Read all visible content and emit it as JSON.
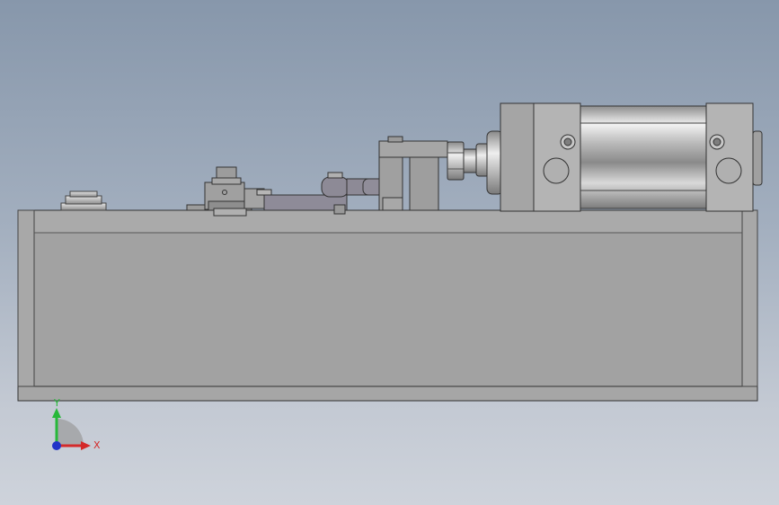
{
  "viewport": {
    "background_top": "#8797ab",
    "background_bottom": "#ced3db"
  },
  "model": {
    "part_color": "#a3a3a3",
    "edge_color": "#3a3a3a",
    "linkage_color": "#8c8996",
    "cylinder_color": "#c9c9c9"
  },
  "triad": {
    "x_label": "X",
    "y_label": "Y",
    "x_color": "#d42a2a",
    "y_color": "#27b83a",
    "z_color": "#2233c8"
  }
}
